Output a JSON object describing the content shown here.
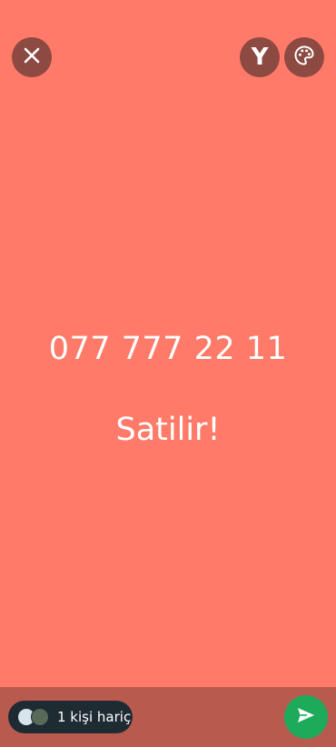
{
  "topbar": {
    "close_icon": "close-icon",
    "text_style_label": "Y",
    "palette_icon": "palette-icon"
  },
  "canvas": {
    "line1": "077 777 22 11",
    "line2": "Satilir!",
    "background_color": "#FF7A68"
  },
  "footer": {
    "audience_label": "1 kişi hariç",
    "send_icon": "send-icon",
    "send_color": "#1DAA5B"
  }
}
